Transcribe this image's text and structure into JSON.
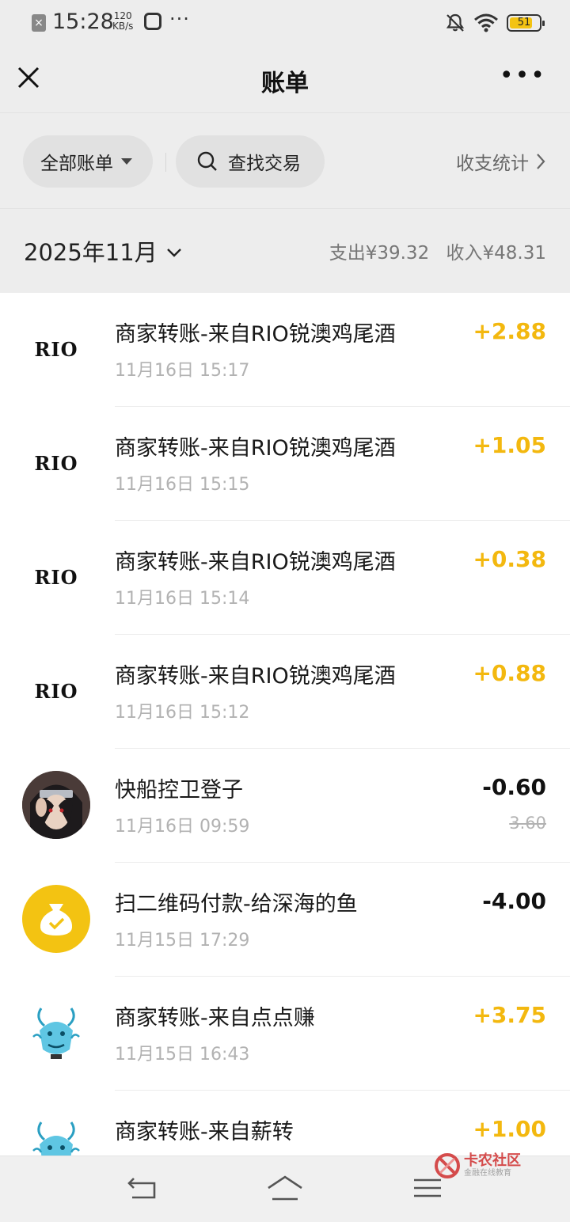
{
  "status_bar": {
    "time": "15:28",
    "net_speed_value": "120",
    "net_speed_unit": "KB/s",
    "more": "···",
    "battery_level": "51"
  },
  "nav": {
    "title": "账单",
    "more_label": "•••"
  },
  "filters": {
    "all_bills": "全部账单",
    "search": "查找交易",
    "stats": "收支统计"
  },
  "month": {
    "label": "2025年11月",
    "expense": "支出¥39.32",
    "income": "收入¥48.31"
  },
  "transactions": [
    {
      "avatar": "RIO",
      "title": "商家转账-来自RIO锐澳鸡尾酒",
      "time": "11月16日 15:17",
      "amount": "+2.88",
      "type": "income"
    },
    {
      "avatar": "RIO",
      "title": "商家转账-来自RIO锐澳鸡尾酒",
      "time": "11月16日 15:15",
      "amount": "+1.05",
      "type": "income"
    },
    {
      "avatar": "RIO",
      "title": "商家转账-来自RIO锐澳鸡尾酒",
      "time": "11月16日 15:14",
      "amount": "+0.38",
      "type": "income"
    },
    {
      "avatar": "RIO",
      "title": "商家转账-来自RIO锐澳鸡尾酒",
      "time": "11月16日 15:12",
      "amount": "+0.88",
      "type": "income"
    },
    {
      "avatar": "anime-portrait",
      "title": "快船控卫登子",
      "time": "11月16日 09:59",
      "amount": "-0.60",
      "original": "3.60",
      "type": "expense"
    },
    {
      "avatar": "money-bag-icon",
      "title": "扫二维码付款-给深海的鱼",
      "time": "11月15日 17:29",
      "amount": "-4.00",
      "type": "expense"
    },
    {
      "avatar": "dragon",
      "title": "商家转账-来自点点赚",
      "time": "11月15日 16:43",
      "amount": "+3.75",
      "type": "income"
    },
    {
      "avatar": "dragon",
      "title": "商家转账-来自薪转",
      "time": "",
      "amount": "+1.00",
      "type": "income"
    }
  ],
  "watermark": {
    "main": "卡农社区",
    "sub": "金融在线教育"
  },
  "colors": {
    "income": "#f3b80f",
    "expense": "#111111",
    "background": "#ededed",
    "battery": "#f3c312",
    "money_bag": "#f3c312"
  }
}
